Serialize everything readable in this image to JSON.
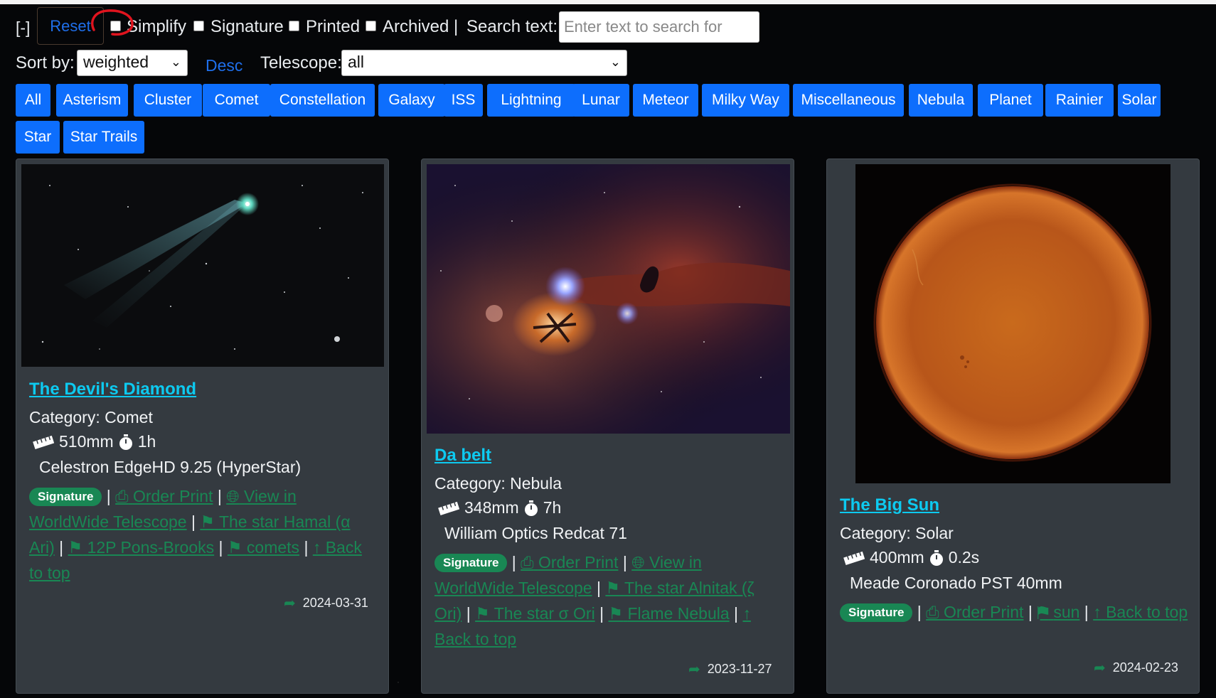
{
  "controls": {
    "collapse_label": "[-]",
    "reset_label": "Reset",
    "simplify_label": "Simplify",
    "signature_label": "Signature",
    "printed_label": "Printed",
    "archived_label": "Archived |",
    "search_label": "Search text:",
    "search_placeholder": "Enter text to search for",
    "sort_label": "Sort by:",
    "sort_value": "weighted",
    "order_label": "Desc",
    "telescope_label": "Telescope:",
    "telescope_value": "all"
  },
  "categories": [
    "All",
    "Asterism",
    "Cluster",
    "Comet",
    "Constellation",
    "Galaxy",
    "ISS",
    "Lightning",
    "Lunar",
    "Meteor",
    "Milky Way",
    "Miscellaneous",
    "Nebula",
    "Planet",
    "Rainier",
    "Solar",
    "Star",
    "Star Trails"
  ],
  "cards": [
    {
      "title": "The Devil's Diamond",
      "category": "Category: Comet",
      "focal": "510mm",
      "exposure": "1h",
      "telescope": "Celestron EdgeHD 9.25 (HyperStar)",
      "badge": "Signature",
      "order_print": "Order Print",
      "view_in_line1": "View in",
      "view_in_line2": "WorldWide Telescope",
      "tags": [
        "The star Hamal (α Ari)",
        "12P Pons-Brooks",
        "comets"
      ],
      "back_to_top": "Back to top",
      "date": "2024-03-31"
    },
    {
      "title": "Da belt",
      "category": "Category: Nebula",
      "focal": "348mm",
      "exposure": "7h",
      "telescope": "William Optics Redcat 71",
      "badge": "Signature",
      "order_print": "Order Print",
      "view_in_line1": "View in",
      "view_in_line2": "WorldWide Telescope",
      "tags": [
        "The star Alnitak (ζ Ori)",
        "The star σ Ori",
        "Flame Nebula"
      ],
      "back_to_top": "Back to top",
      "date": "2023-11-27"
    },
    {
      "title": "The Big Sun",
      "category": "Category: Solar",
      "focal": "400mm",
      "exposure": "0.2s",
      "telescope": "Meade Coronado PST 40mm",
      "badge": "Signature",
      "order_print": "Order Print",
      "tags": [
        "sun"
      ],
      "back_to_top": "Back to top",
      "date": "2024-02-23"
    }
  ],
  "colors": {
    "pill": "#0d6efd",
    "title_link": "#0dcaf0",
    "tag_link": "#198754",
    "card_bg": "#343a40"
  }
}
